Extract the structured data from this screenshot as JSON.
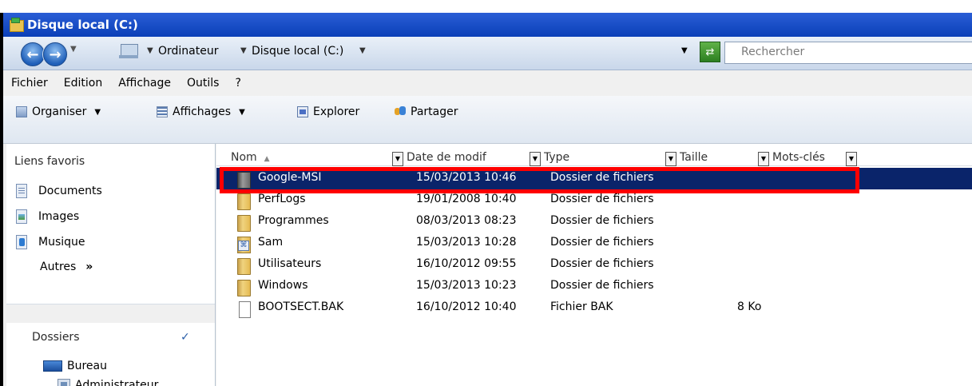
{
  "window": {
    "title": "Disque local (C:)"
  },
  "address": {
    "crumbs": [
      "Ordinateur",
      "Disque local (C:)"
    ],
    "search_placeholder": "Rechercher"
  },
  "menu": [
    "Fichier",
    "Edition",
    "Affichage",
    "Outils",
    "?"
  ],
  "toolbar": {
    "organiser": "Organiser",
    "affichages": "Affichages",
    "explorer": "Explorer",
    "partager": "Partager"
  },
  "sidebar": {
    "favorites_header": "Liens favoris",
    "items": [
      "Documents",
      "Images",
      "Musique"
    ],
    "autres": "Autres",
    "autres_chevron": "»",
    "dossiers_header": "Dossiers",
    "tree": [
      "Bureau",
      "Administrateur"
    ]
  },
  "columns": [
    "Nom",
    "Date de modif",
    "Type",
    "Taille",
    "Mots-clés"
  ],
  "files": [
    {
      "name": "Google-MSI",
      "date": "15/03/2013 10:46",
      "type": "Dossier de fichiers",
      "size": "",
      "icon": "folder-selected",
      "selected": true
    },
    {
      "name": "PerfLogs",
      "date": "19/01/2008 10:40",
      "type": "Dossier de fichiers",
      "size": "",
      "icon": "folder"
    },
    {
      "name": "Programmes",
      "date": "08/03/2013 08:23",
      "type": "Dossier de fichiers",
      "size": "",
      "icon": "folder"
    },
    {
      "name": "Sam",
      "date": "15/03/2013 10:28",
      "type": "Dossier de fichiers",
      "size": "",
      "icon": "user-folder"
    },
    {
      "name": "Utilisateurs",
      "date": "16/10/2012 09:55",
      "type": "Dossier de fichiers",
      "size": "",
      "icon": "folder"
    },
    {
      "name": "Windows",
      "date": "15/03/2013 10:23",
      "type": "Dossier de fichiers",
      "size": "",
      "icon": "folder"
    },
    {
      "name": "BOOTSECT.BAK",
      "date": "16/10/2012 10:40",
      "type": "Fichier BAK",
      "size": "8 Ko",
      "icon": "file"
    }
  ],
  "colors": {
    "selection": "#0a246a",
    "highlight": "#ff0000",
    "titlebar": "#0a3fb8"
  }
}
